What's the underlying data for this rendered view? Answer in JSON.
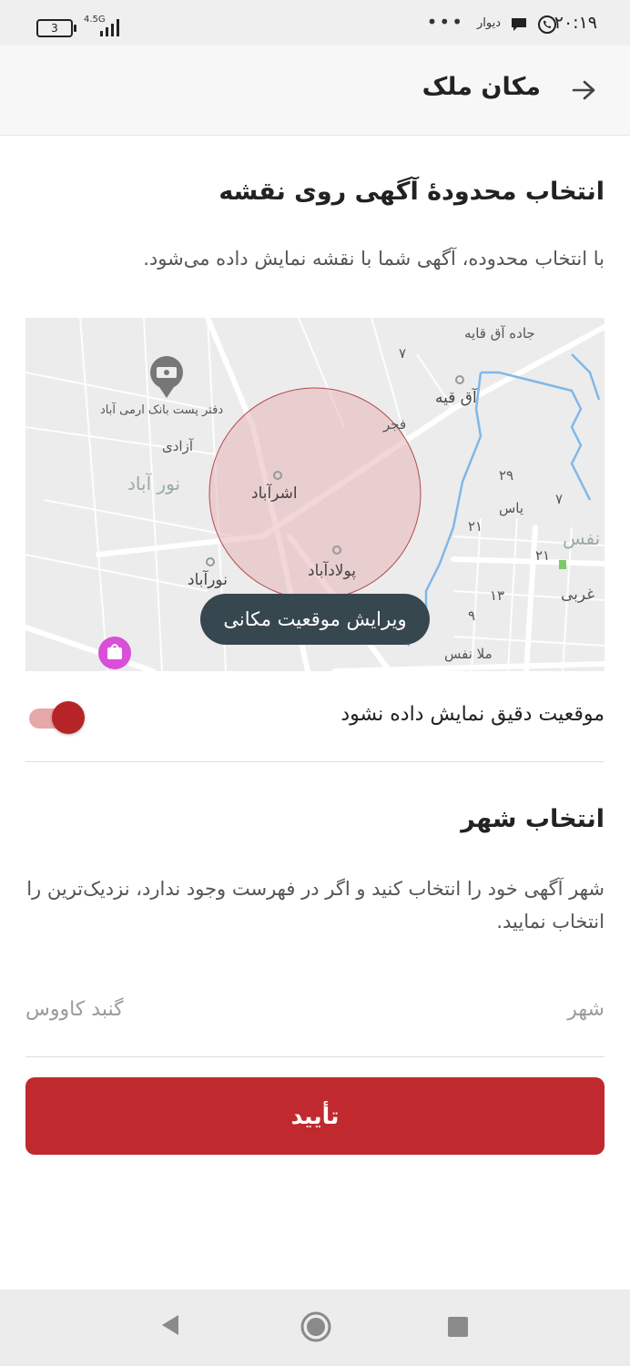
{
  "status_bar": {
    "time": "۲۰:۱۹",
    "app_label": "دیوار",
    "more": "•••",
    "battery": "3",
    "network": "4.5G"
  },
  "header": {
    "title": "مکان ملک"
  },
  "area_section": {
    "title": "انتخاب محدودهٔ آگهی روی نقشه",
    "description": "با انتخاب محدوده، آگهی شما با نقشه نمایش داده می‌شود."
  },
  "map": {
    "edit_button": "ویرایش موقعیت مکانی",
    "labels": {
      "jade": "جاده آق قایه",
      "aghghaye": "آق قیه",
      "fajr": "فجر",
      "bank": "دفتر پست بانک ارمی آباد",
      "azadi": "آزادی",
      "noorabad_big": "نور آباد",
      "ashrafabad": "اشرآباد",
      "poladabad": "پولادآباد",
      "noorabad": "نورآباد",
      "yas": "یاس",
      "nafas": "نفس",
      "gharbi": "غربی",
      "mola_nafas": "ملا نفس",
      "n29": "۲۹",
      "n21a": "۲۱",
      "n21b": "۲۱",
      "n7a": "۷",
      "n7b": "۷",
      "n13": "۱۳",
      "n9": "۹"
    },
    "colors": {
      "circle_fill": "#e8b6b8",
      "water": "#7fb8e8",
      "road": "#ffffff"
    }
  },
  "location_toggle": {
    "label": "موقعیت دقیق نمایش داده نشود",
    "enabled": true
  },
  "city_section": {
    "title": "انتخاب شهر",
    "description": "شهر آگهی خود را انتخاب کنید و اگر در فهرست وجود ندارد، نزدیک‌ترین را انتخاب نمایید.",
    "field_label": "شهر",
    "field_value": "گنبد کاووس"
  },
  "confirm_button": "تأیید",
  "colors": {
    "accent": "#c0292e",
    "edit_button_bg": "#37474f"
  }
}
